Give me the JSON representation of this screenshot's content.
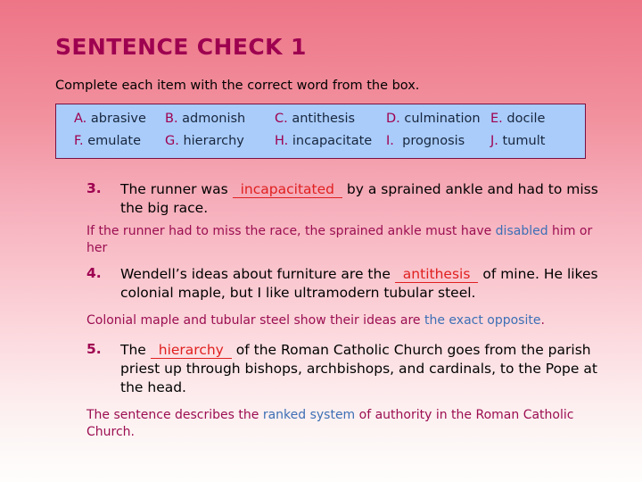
{
  "slide": {
    "title": "SENTENCE CHECK 1",
    "instruction": "Complete each item with the correct word from the box."
  },
  "wordbox": {
    "row1": [
      {
        "letter": "A.",
        "word": "abrasive"
      },
      {
        "letter": "B.",
        "word": "admonish"
      },
      {
        "letter": "C.",
        "word": "antithesis"
      },
      {
        "letter": "D.",
        "word": "culmination"
      },
      {
        "letter": "E.",
        "word": "docile"
      }
    ],
    "row2": [
      {
        "letter": "F.",
        "word": "emulate"
      },
      {
        "letter": "G.",
        "word": "hierarchy"
      },
      {
        "letter": "H.",
        "word": "incapacitate"
      },
      {
        "letter": "I.",
        "word": "prognosis"
      },
      {
        "letter": "J.",
        "word": "tumult"
      }
    ]
  },
  "items": [
    {
      "number": "3.",
      "before": "The runner was ",
      "answer": "incapacitated",
      "after": " by a sprained ankle and had to miss the big race.",
      "explanation_pre": "If the runner had to miss the race, the sprained ankle must have ",
      "explanation_highlight": "disabled",
      "explanation_post": " him or her"
    },
    {
      "number": "4.",
      "before": "Wendell’s ideas about furniture are the ",
      "answer": "antithesis",
      "after": " of mine. He likes colonial maple, but I like ultramodern tubular steel.",
      "explanation_pre": "Colonial maple and tubular steel show their ideas are ",
      "explanation_highlight": "the exact opposite",
      "explanation_post": "."
    },
    {
      "number": "5.",
      "before": "The ",
      "answer": "hierarchy",
      "after": " of the Roman Catholic Church goes from the parish priest up through bishops, archbishops, and cardinals, to the Pope at the head.",
      "explanation_pre": "The sentence describes the ",
      "explanation_highlight": "ranked system",
      "explanation_post": " of authority in the Roman Catholic Church."
    }
  ],
  "colors": {
    "background_top": "#ed7586",
    "background_bottom": "#fefdfc",
    "title": "#9e0050",
    "wordbox_fill": "#aaccfa",
    "wordbox_border": "#7a1040",
    "answer": "#e02020",
    "explanation": "#9b0e51",
    "explanation_highlight": "#3d6fb5",
    "body_text": "#000000"
  }
}
